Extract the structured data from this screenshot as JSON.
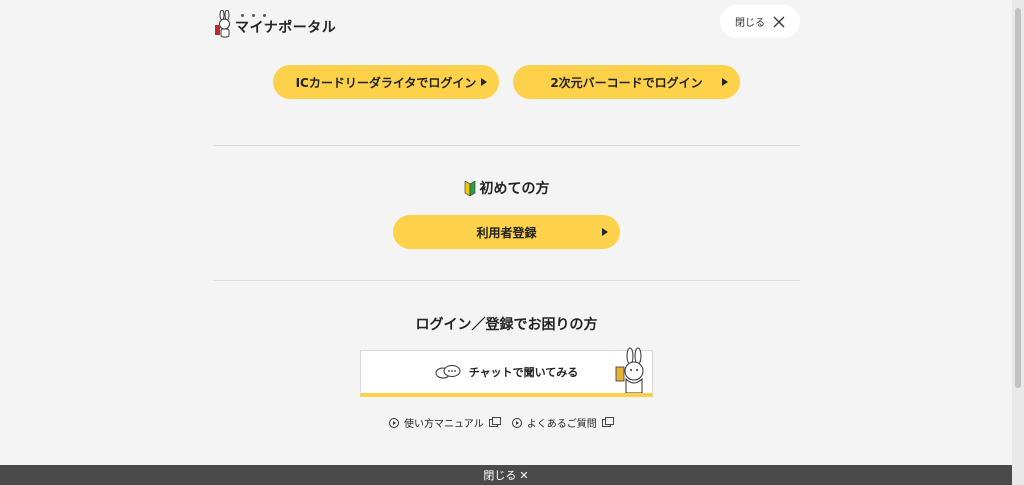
{
  "header": {
    "logo_text": "マイナポータル",
    "close_label": "閉じる"
  },
  "login": {
    "ic_card_label": "ICカードリーダライタでログイン",
    "qr_code_label": "2次元バーコードでログイン"
  },
  "first_time": {
    "heading": "初めての方",
    "register_label": "利用者登録"
  },
  "help": {
    "heading": "ログイン／登録でお困りの方",
    "chat_label": "チャットで聞いてみる",
    "links": [
      {
        "label": "使い方マニュアル"
      },
      {
        "label": "よくあるご質問"
      }
    ]
  },
  "footer": {
    "close_label": "閉じる",
    "close_glyph": "✕"
  },
  "colors": {
    "accent": "#fdd14a",
    "background": "#f4f4f4",
    "footer_bar": "#4a4a4a"
  }
}
